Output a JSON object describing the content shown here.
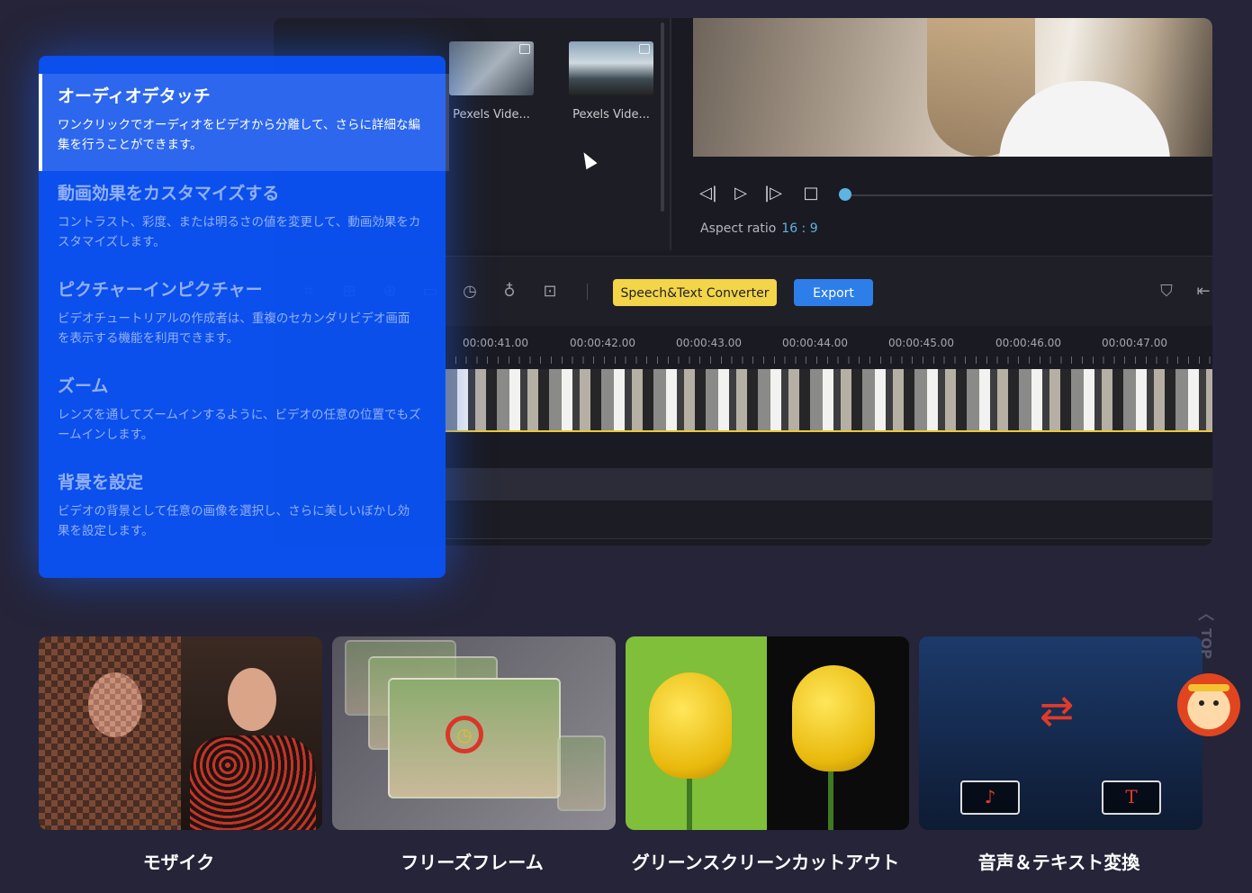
{
  "media_bin": {
    "items": [
      {
        "name": "Pexels Vide..."
      },
      {
        "name": "Pexels Vide..."
      }
    ]
  },
  "player": {
    "prev_icon": "prev-frame-icon",
    "play_icon": "play-icon",
    "next_icon": "next-frame-icon",
    "stop_icon": "stop-icon",
    "aspect_label": "Aspect ratio",
    "aspect_value": "16 : 9"
  },
  "toolbar": {
    "speech_label": "Speech&Text Converter",
    "export_label": "Export",
    "speech_color": "#f3d54a",
    "export_color": "#2d7ee8"
  },
  "timeline": {
    "ticks": [
      "00:00:41.00",
      "00:00:42.00",
      "00:00:43.00",
      "00:00:44.00",
      "00:00:45.00",
      "00:00:46.00",
      "00:00:47.00"
    ]
  },
  "features": [
    {
      "title": "オーディオデタッチ",
      "desc": "ワンクリックでオーディオをビデオから分離して、さらに詳細な編集を行うことができます。",
      "active": true
    },
    {
      "title": "動画効果をカスタマイズする",
      "desc": "コントラスト、彩度、または明るさの値を変更して、動画効果をカスタマイズします。",
      "active": false
    },
    {
      "title": "ピクチャーインピクチャー",
      "desc": "ビデオチュートリアルの作成者は、重複のセカンダリビデオ画面を表示する機能を利用できます。",
      "active": false
    },
    {
      "title": "ズーム",
      "desc": "レンズを通してズームインするように、ビデオの任意の位置でもズームインします。",
      "active": false
    },
    {
      "title": "背景を設定",
      "desc": "ビデオの背景として任意の画像を選択し、さらに美しいぼかし効果を設定します。",
      "active": false
    }
  ],
  "cards": [
    {
      "label": "モザイク"
    },
    {
      "label": "フリーズフレーム"
    },
    {
      "label": "グリーンスクリーンカットアウト"
    },
    {
      "label": "音声＆テキスト変換"
    }
  ],
  "top_link": {
    "label": "TOP"
  },
  "accent_color": "#0a52f6"
}
